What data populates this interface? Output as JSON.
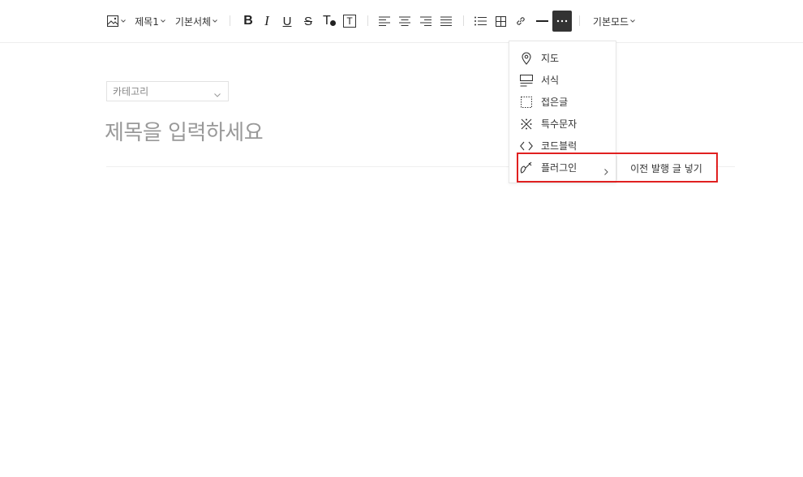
{
  "toolbar": {
    "image_icon": "image-icon",
    "heading_label": "제목1",
    "font_label": "기본서체",
    "bold_label": "B",
    "italic_label": "I",
    "underline_label": "U",
    "strike_label": "S",
    "text_color_label": "T",
    "text_bg_label": "T",
    "mode_label": "기본모드"
  },
  "editor": {
    "category_placeholder": "카테고리",
    "title_placeholder": "제목을 입력하세요"
  },
  "more_menu": {
    "items": [
      {
        "label": "지도",
        "icon": "map-pin-icon"
      },
      {
        "label": "서식",
        "icon": "template-icon"
      },
      {
        "label": "접은글",
        "icon": "fold-icon"
      },
      {
        "label": "특수문자",
        "icon": "special-char-icon"
      },
      {
        "label": "코드블럭",
        "icon": "code-icon"
      },
      {
        "label": "플러그인",
        "icon": "plugin-icon"
      }
    ],
    "submenu_label": "이전 발행 글 넣기"
  },
  "colors": {
    "highlight": "#e02020",
    "active_button": "#333333"
  }
}
